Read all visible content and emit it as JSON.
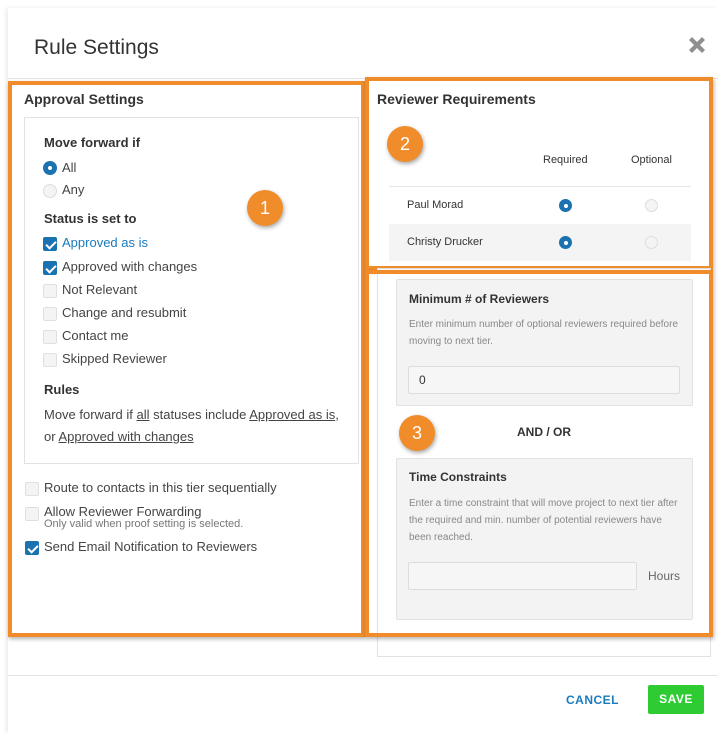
{
  "dialog": {
    "title": "Rule Settings",
    "close_icon": "close-icon"
  },
  "approval": {
    "heading": "Approval Settings",
    "move_forward_label": "Move forward if",
    "move_forward_options": [
      {
        "label": "All",
        "selected": true
      },
      {
        "label": "Any",
        "selected": false
      }
    ],
    "status_label": "Status is set to",
    "statuses": [
      {
        "label": "Approved as is",
        "checked": true
      },
      {
        "label": "Approved with changes",
        "checked": true
      },
      {
        "label": "Not Relevant",
        "checked": false
      },
      {
        "label": "Change and resubmit",
        "checked": false
      },
      {
        "label": "Contact me",
        "checked": false
      },
      {
        "label": "Skipped Reviewer",
        "checked": false
      }
    ],
    "rules_label": "Rules",
    "rules_text": {
      "p1": "Move forward if ",
      "all": "all",
      "p2": " statuses include ",
      "approved_as_is": "Approved as is",
      "p3": ",",
      "p4": "or ",
      "approved_with_changes": "Approved with changes"
    },
    "options": [
      {
        "label": "Route to contacts in this tier sequentially",
        "checked": false
      },
      {
        "label": "Allow Reviewer Forwarding",
        "note": "Only valid when proof setting is selected.",
        "checked": false
      },
      {
        "label": "Send Email Notification to Reviewers",
        "checked": true
      }
    ]
  },
  "reviewers": {
    "heading": "Reviewer Requirements",
    "col_required": "Required",
    "col_optional": "Optional",
    "rows": [
      {
        "name": "Paul Morad",
        "required": true
      },
      {
        "name": "Christy Drucker",
        "required": true
      }
    ]
  },
  "minimum": {
    "title": "Minimum # of Reviewers",
    "description": "Enter minimum number of optional reviewers required before moving to next tier.",
    "value": "0"
  },
  "and_or": "AND / OR",
  "time": {
    "title": "Time Constraints",
    "description": "Enter a time constraint that will move project to next tier after the required and min. number of potential reviewers have been reached.",
    "value": "",
    "unit": "Hours"
  },
  "badges": [
    "1",
    "2",
    "3"
  ],
  "footer": {
    "cancel": "CANCEL",
    "save": "SAVE"
  },
  "colors": {
    "highlight": "#f08c2a",
    "primary": "#1a72b0",
    "save": "#2ecc32"
  }
}
